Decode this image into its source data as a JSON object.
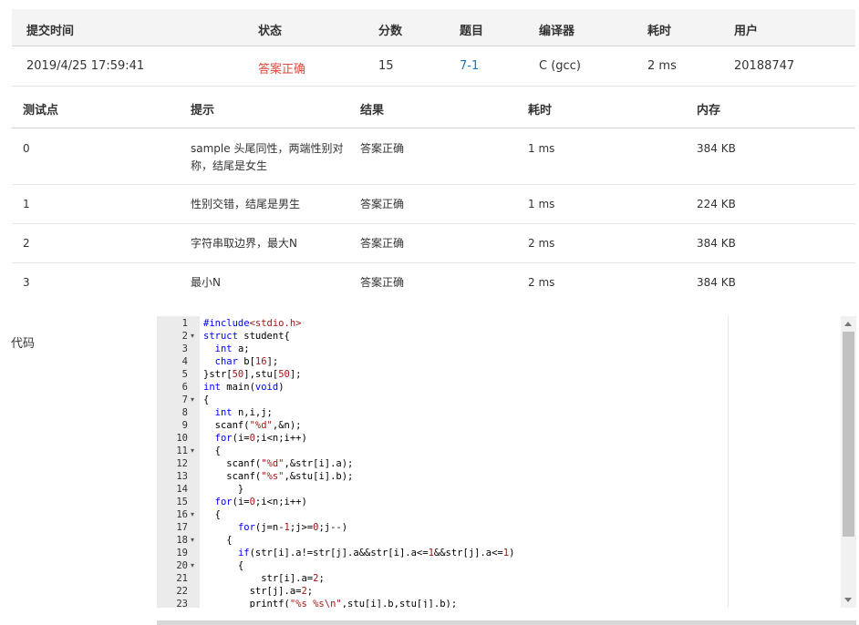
{
  "submission": {
    "headers": {
      "time": "提交时间",
      "status": "状态",
      "score": "分数",
      "problem": "题目",
      "compiler": "编译器",
      "elapsed": "耗时",
      "user": "用户"
    },
    "row": {
      "time": "2019/4/25 17:59:41",
      "status": "答案正确",
      "score": "15",
      "problem": "7-1",
      "compiler": "C (gcc)",
      "elapsed": "2 ms",
      "user": "20188747"
    }
  },
  "testcases": {
    "headers": {
      "id": "测试点",
      "hint": "提示",
      "result": "结果",
      "elapsed": "耗时",
      "memory": "内存"
    },
    "rows": [
      {
        "id": "0",
        "hint": "sample 头尾同性，两端性别对称，结尾是女生",
        "result": "答案正确",
        "elapsed": "1 ms",
        "memory": "384 KB"
      },
      {
        "id": "1",
        "hint": "性别交错，结尾是男生",
        "result": "答案正确",
        "elapsed": "1 ms",
        "memory": "224 KB"
      },
      {
        "id": "2",
        "hint": "字符串取边界，最大N",
        "result": "答案正确",
        "elapsed": "2 ms",
        "memory": "384 KB"
      },
      {
        "id": "3",
        "hint": "最小N",
        "result": "答案正确",
        "elapsed": "2 ms",
        "memory": "384 KB"
      }
    ]
  },
  "code": {
    "label": "代码",
    "lines": [
      {
        "n": "1",
        "fold": false,
        "tokens": [
          {
            "t": "kw",
            "v": "#include"
          },
          {
            "t": "str",
            "v": "<stdio.h>"
          }
        ]
      },
      {
        "n": "2",
        "fold": true,
        "tokens": [
          {
            "t": "kw",
            "v": "struct"
          },
          {
            "t": "txt",
            "v": " student{"
          }
        ]
      },
      {
        "n": "3",
        "fold": false,
        "tokens": [
          {
            "t": "txt",
            "v": "  "
          },
          {
            "t": "kw",
            "v": "int"
          },
          {
            "t": "txt",
            "v": " a;"
          }
        ]
      },
      {
        "n": "4",
        "fold": false,
        "tokens": [
          {
            "t": "txt",
            "v": "  "
          },
          {
            "t": "kw",
            "v": "char"
          },
          {
            "t": "txt",
            "v": " b["
          },
          {
            "t": "str",
            "v": "16"
          },
          {
            "t": "txt",
            "v": "];"
          }
        ]
      },
      {
        "n": "5",
        "fold": false,
        "tokens": [
          {
            "t": "txt",
            "v": "}str["
          },
          {
            "t": "str",
            "v": "50"
          },
          {
            "t": "txt",
            "v": "],stu["
          },
          {
            "t": "str",
            "v": "50"
          },
          {
            "t": "txt",
            "v": "];"
          }
        ]
      },
      {
        "n": "6",
        "fold": false,
        "tokens": [
          {
            "t": "kw",
            "v": "int"
          },
          {
            "t": "txt",
            "v": " main("
          },
          {
            "t": "kw",
            "v": "void"
          },
          {
            "t": "txt",
            "v": ")"
          }
        ]
      },
      {
        "n": "7",
        "fold": true,
        "tokens": [
          {
            "t": "txt",
            "v": "{"
          }
        ]
      },
      {
        "n": "8",
        "fold": false,
        "tokens": [
          {
            "t": "txt",
            "v": "  "
          },
          {
            "t": "kw",
            "v": "int"
          },
          {
            "t": "txt",
            "v": " n,i,j;"
          }
        ]
      },
      {
        "n": "9",
        "fold": false,
        "tokens": [
          {
            "t": "txt",
            "v": "  scanf("
          },
          {
            "t": "str",
            "v": "\"%d\""
          },
          {
            "t": "txt",
            "v": ",&n);"
          }
        ]
      },
      {
        "n": "10",
        "fold": false,
        "tokens": [
          {
            "t": "txt",
            "v": "  "
          },
          {
            "t": "kw",
            "v": "for"
          },
          {
            "t": "txt",
            "v": "(i="
          },
          {
            "t": "str",
            "v": "0"
          },
          {
            "t": "txt",
            "v": ";i<n;i++)"
          }
        ]
      },
      {
        "n": "11",
        "fold": true,
        "tokens": [
          {
            "t": "txt",
            "v": "  {"
          }
        ]
      },
      {
        "n": "12",
        "fold": false,
        "tokens": [
          {
            "t": "txt",
            "v": "    scanf("
          },
          {
            "t": "str",
            "v": "\"%d\""
          },
          {
            "t": "txt",
            "v": ",&str[i].a);"
          }
        ]
      },
      {
        "n": "13",
        "fold": false,
        "tokens": [
          {
            "t": "txt",
            "v": "    scanf("
          },
          {
            "t": "str",
            "v": "\"%s\""
          },
          {
            "t": "txt",
            "v": ",&stu[i].b);"
          }
        ]
      },
      {
        "n": "14",
        "fold": false,
        "tokens": [
          {
            "t": "txt",
            "v": "      }"
          }
        ]
      },
      {
        "n": "15",
        "fold": false,
        "tokens": [
          {
            "t": "txt",
            "v": "  "
          },
          {
            "t": "kw",
            "v": "for"
          },
          {
            "t": "txt",
            "v": "(i="
          },
          {
            "t": "str",
            "v": "0"
          },
          {
            "t": "txt",
            "v": ";i<n;i++)"
          }
        ]
      },
      {
        "n": "16",
        "fold": true,
        "tokens": [
          {
            "t": "txt",
            "v": "  {"
          }
        ]
      },
      {
        "n": "17",
        "fold": false,
        "tokens": [
          {
            "t": "txt",
            "v": "      "
          },
          {
            "t": "kw",
            "v": "for"
          },
          {
            "t": "txt",
            "v": "(j=n-"
          },
          {
            "t": "str",
            "v": "1"
          },
          {
            "t": "txt",
            "v": ";j>="
          },
          {
            "t": "str",
            "v": "0"
          },
          {
            "t": "txt",
            "v": ";j--)"
          }
        ]
      },
      {
        "n": "18",
        "fold": true,
        "tokens": [
          {
            "t": "txt",
            "v": "    {"
          }
        ]
      },
      {
        "n": "19",
        "fold": false,
        "tokens": [
          {
            "t": "txt",
            "v": "      "
          },
          {
            "t": "kw",
            "v": "if"
          },
          {
            "t": "txt",
            "v": "(str[i].a!=str[j].a&&str[i].a<="
          },
          {
            "t": "str",
            "v": "1"
          },
          {
            "t": "txt",
            "v": "&&str[j].a<="
          },
          {
            "t": "str",
            "v": "1"
          },
          {
            "t": "txt",
            "v": ")"
          }
        ]
      },
      {
        "n": "20",
        "fold": true,
        "tokens": [
          {
            "t": "txt",
            "v": "      {"
          }
        ]
      },
      {
        "n": "21",
        "fold": false,
        "tokens": [
          {
            "t": "txt",
            "v": "          str[i].a="
          },
          {
            "t": "str",
            "v": "2"
          },
          {
            "t": "txt",
            "v": ";"
          }
        ]
      },
      {
        "n": "22",
        "fold": false,
        "tokens": [
          {
            "t": "txt",
            "v": "        str[j].a="
          },
          {
            "t": "str",
            "v": "2"
          },
          {
            "t": "txt",
            "v": ";"
          }
        ]
      },
      {
        "n": "23",
        "fold": false,
        "tokens": [
          {
            "t": "txt",
            "v": "        printf("
          },
          {
            "t": "str",
            "v": "\"%s %s\\n\""
          },
          {
            "t": "txt",
            "v": ",stu[i].b,stu[j].b);"
          }
        ]
      }
    ]
  },
  "colors": {
    "accepted": "#e3483b",
    "link": "#2574b4",
    "keyword": "#0000ff",
    "literal": "#a31515",
    "gutter": "#ebebeb",
    "header_bg": "#f4f4f5"
  },
  "icons": {
    "fold": "fold-arrow-icon",
    "scroll_up": "scroll-up-icon",
    "scroll_down": "scroll-down-icon"
  }
}
